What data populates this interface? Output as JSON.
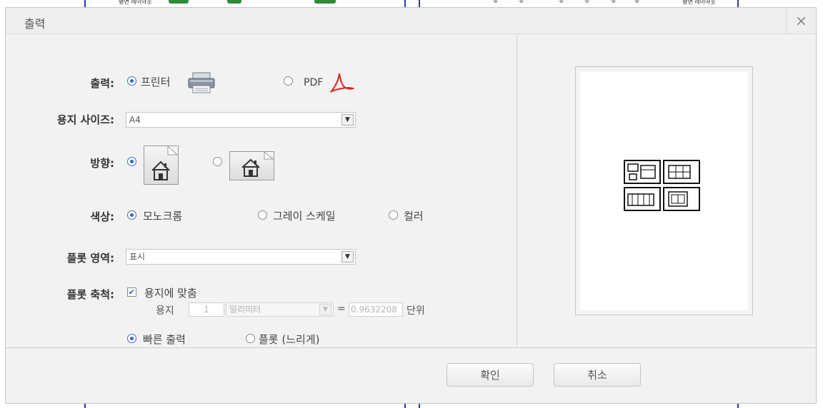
{
  "background": {
    "labels": [
      "평면 레이아웃",
      "평면 레이아웃"
    ],
    "markers": [
      "⑤",
      "⑤",
      "⑤",
      "⑤",
      "⑤",
      "⑤"
    ]
  },
  "dialog": {
    "title": "출력",
    "close_glyph": "×"
  },
  "output": {
    "label": "출력:",
    "printer_label": "프린터",
    "pdf_label": "PDF",
    "selected": "printer"
  },
  "paper_size": {
    "label": "용지 사이즈:",
    "value": "A4"
  },
  "orientation": {
    "label": "방향:",
    "selected": "portrait"
  },
  "color": {
    "label": "색상:",
    "options": [
      "모노크롬",
      "그레이 스케일",
      "컬러"
    ],
    "selected": "모노크롬"
  },
  "plot_area": {
    "label": "플롯 영역:",
    "value": "표시"
  },
  "plot_scale": {
    "label": "플롯 축척:",
    "fit_label": "용지에 맞춤",
    "fit_checked": true,
    "paper_label": "용지",
    "paper_value": "1",
    "unit_value": "밀리미터",
    "equals": "=",
    "ratio_value": "0.9632208",
    "unit_suffix": "단위"
  },
  "plot_mode": {
    "fast_label": "빠른 출력",
    "slow_label": "플롯 (느리게)",
    "selected": "fast"
  },
  "buttons": {
    "ok": "확인",
    "cancel": "취소"
  },
  "colors": {
    "accent": "#3768c6",
    "pdf_red": "#e02020",
    "cad_blue": "#2a37b8",
    "cad_green": "#2f8a3a"
  }
}
